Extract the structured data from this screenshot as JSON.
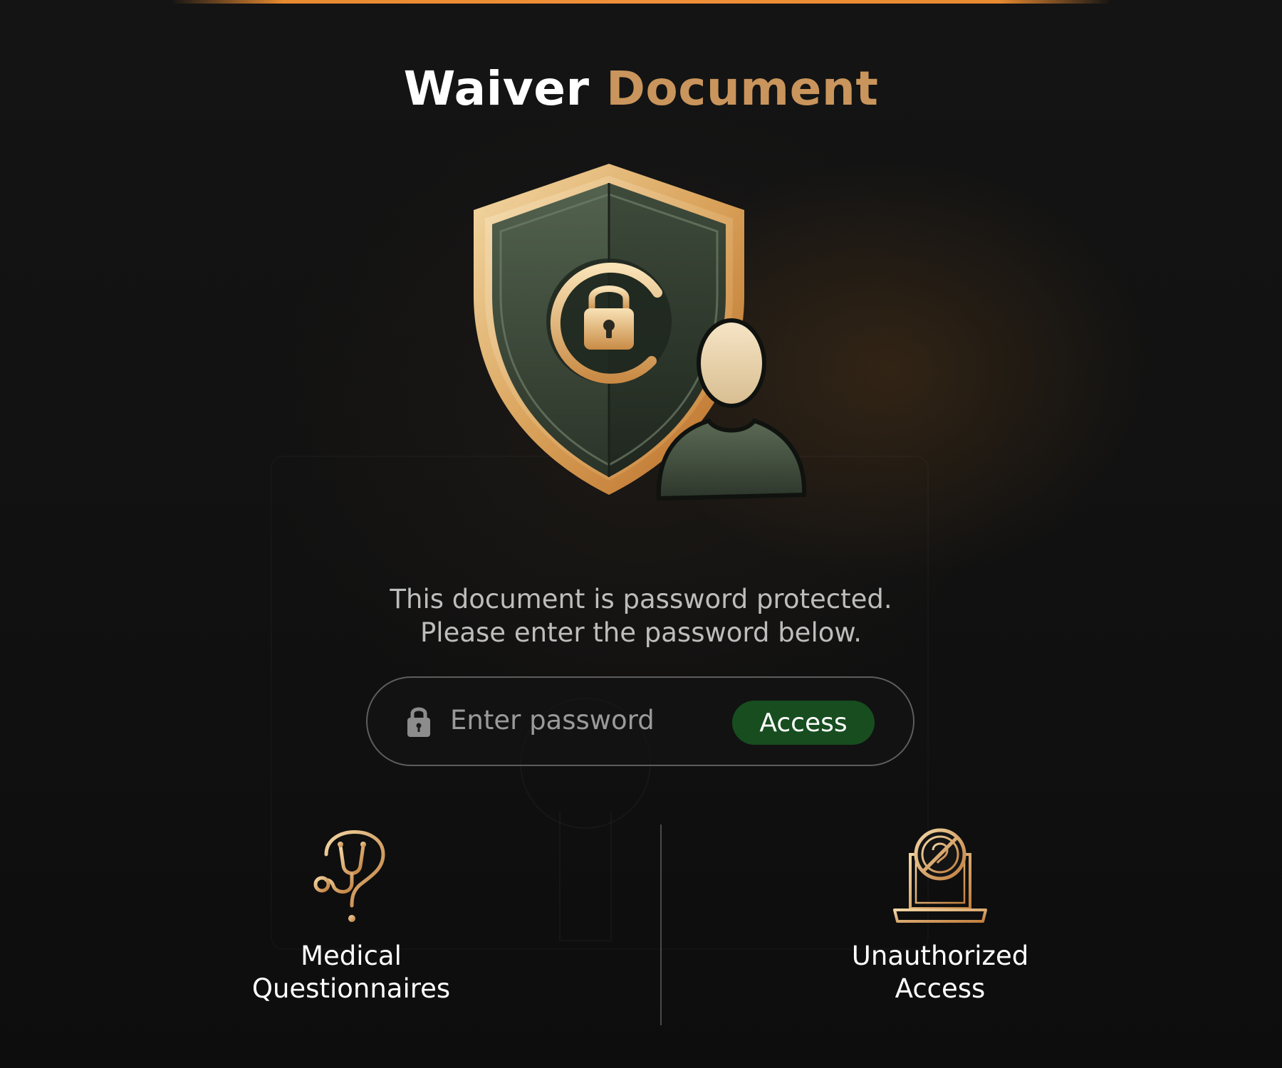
{
  "title": {
    "part1": "Waiver",
    "part2": "Document"
  },
  "hero": {
    "icon": "shield-lock-user-icon"
  },
  "message": {
    "line1": "This document is password protected.",
    "line2": "Please enter the password below."
  },
  "password": {
    "placeholder": "Enter password",
    "value": "",
    "icon": "lock-icon",
    "button_label": "Access"
  },
  "features": [
    {
      "label": "Medical\nQuestionnaires",
      "icon": "stethoscope-question-icon"
    },
    {
      "label": "Unauthorized\nAccess",
      "icon": "laptop-blocked-icon"
    }
  ],
  "colors": {
    "background": "#111111",
    "accent_orange": "#f0903a",
    "gold": "#c9955c",
    "button_green": "#174d1f",
    "text_white": "#ffffff",
    "text_muted": "#bdbdbd"
  }
}
